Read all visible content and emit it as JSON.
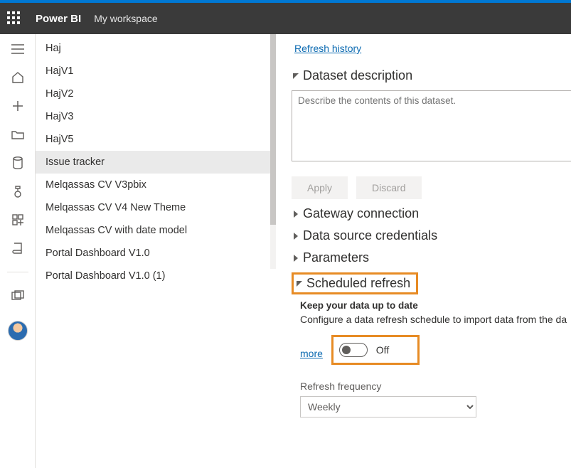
{
  "header": {
    "brand": "Power BI",
    "breadcrumb": "My workspace"
  },
  "leftnav_icons": [
    "menu",
    "home",
    "new",
    "browse",
    "data-hub",
    "metrics",
    "apps",
    "learn",
    "workspaces"
  ],
  "workspace_items": [
    "Haj",
    "HajV1",
    "HajV2",
    "HajV3",
    "HajV5",
    "Issue tracker",
    "Melqassas CV V3pbix",
    "Melqassas CV V4 New Theme",
    "Melqassas CV with date model",
    "Portal Dashboard V1.0",
    "Portal Dashboard V1.0 (1)"
  ],
  "selected_item_index": 5,
  "right": {
    "refresh_history": "Refresh history",
    "dataset_description_title": "Dataset description",
    "desc_placeholder": "Describe the contents of this dataset.",
    "apply": "Apply",
    "discard": "Discard",
    "gateway_connection": "Gateway connection",
    "data_source_credentials": "Data source credentials",
    "parameters": "Parameters",
    "scheduled_refresh": "Scheduled refresh",
    "keep_up": "Keep your data up to date",
    "configure_text": "Configure a data refresh schedule to import data from the da",
    "learn_more": "more",
    "toggle_state": "Off",
    "refresh_frequency_label": "Refresh frequency",
    "refresh_frequency_value": "Weekly"
  }
}
